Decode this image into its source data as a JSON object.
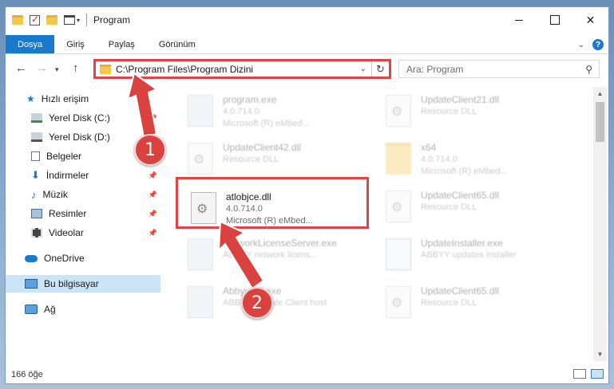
{
  "window": {
    "title": "Program",
    "tabs": [
      "Dosya",
      "Giriş",
      "Paylaş",
      "Görünüm"
    ],
    "address": "C:\\Program Files\\Program Dizini",
    "search_placeholder": "Ara: Program"
  },
  "sidebar": {
    "items": [
      {
        "label": "Hızlı erişim",
        "icon": "star-icon",
        "pinned": false
      },
      {
        "label": "Yerel Disk (C:)",
        "icon": "drive-icon",
        "pinned": true
      },
      {
        "label": "Yerel Disk (D:)",
        "icon": "drive-icon",
        "pinned": false
      },
      {
        "label": "Belgeler",
        "icon": "document-icon",
        "pinned": true
      },
      {
        "label": "İndirmeler",
        "icon": "download-icon",
        "pinned": true
      },
      {
        "label": "Müzik",
        "icon": "music-icon",
        "pinned": true
      },
      {
        "label": "Resimler",
        "icon": "picture-icon",
        "pinned": true
      },
      {
        "label": "Videolar",
        "icon": "video-icon",
        "pinned": true
      },
      {
        "label": "OneDrive",
        "icon": "cloud-icon",
        "pinned": false
      },
      {
        "label": "Bu bilgisayar",
        "icon": "computer-icon",
        "pinned": false
      },
      {
        "label": "Ağ",
        "icon": "network-icon",
        "pinned": false
      }
    ]
  },
  "files": [
    {
      "name": "program.exe",
      "line2": "4.0.714.0",
      "line3": "Microsoft (R) eMbed...",
      "icon": "exe-icon"
    },
    {
      "name": "UpdateClient21.dll",
      "line2": "Resource DLL",
      "line3": "",
      "icon": "dll-icon"
    },
    {
      "name": "UpdateClient42.dll",
      "line2": "Resource DLL",
      "line3": "",
      "icon": "dll-icon"
    },
    {
      "name": "x64",
      "line2": "4.0.714.0",
      "line3": "Microsoft (R) eMbed...",
      "icon": "folder-icon"
    },
    {
      "name": "atlobjce.dll",
      "line2": "4.0.714.0",
      "line3": "Microsoft (R) eMbed...",
      "icon": "dll-icon"
    },
    {
      "name": "UpdateClient65.dll",
      "line2": "Resource DLL",
      "line3": "",
      "icon": "dll-icon"
    },
    {
      "name": "NetworkLicenseServer.exe",
      "line2": "ABBYY network licens...",
      "line3": "",
      "icon": "exe-icon"
    },
    {
      "name": "UpdateInstaller.exe",
      "line2": "ABBYY updates installer",
      "line3": "",
      "icon": "installer-icon"
    },
    {
      "name": "AbbyyCU.exe",
      "line2": "ABBYY Update Client host",
      "line3": "",
      "icon": "exe-icon"
    },
    {
      "name": "UpdateClient65.dll",
      "line2": "Resource DLL",
      "line3": "",
      "icon": "dll-icon"
    }
  ],
  "status": {
    "item_count": "166 öğe"
  },
  "annotations": {
    "badge1": "1",
    "badge2": "2"
  },
  "colors": {
    "accent": "#1979ca",
    "highlight": "#e04545",
    "badge": "#d9423f"
  }
}
